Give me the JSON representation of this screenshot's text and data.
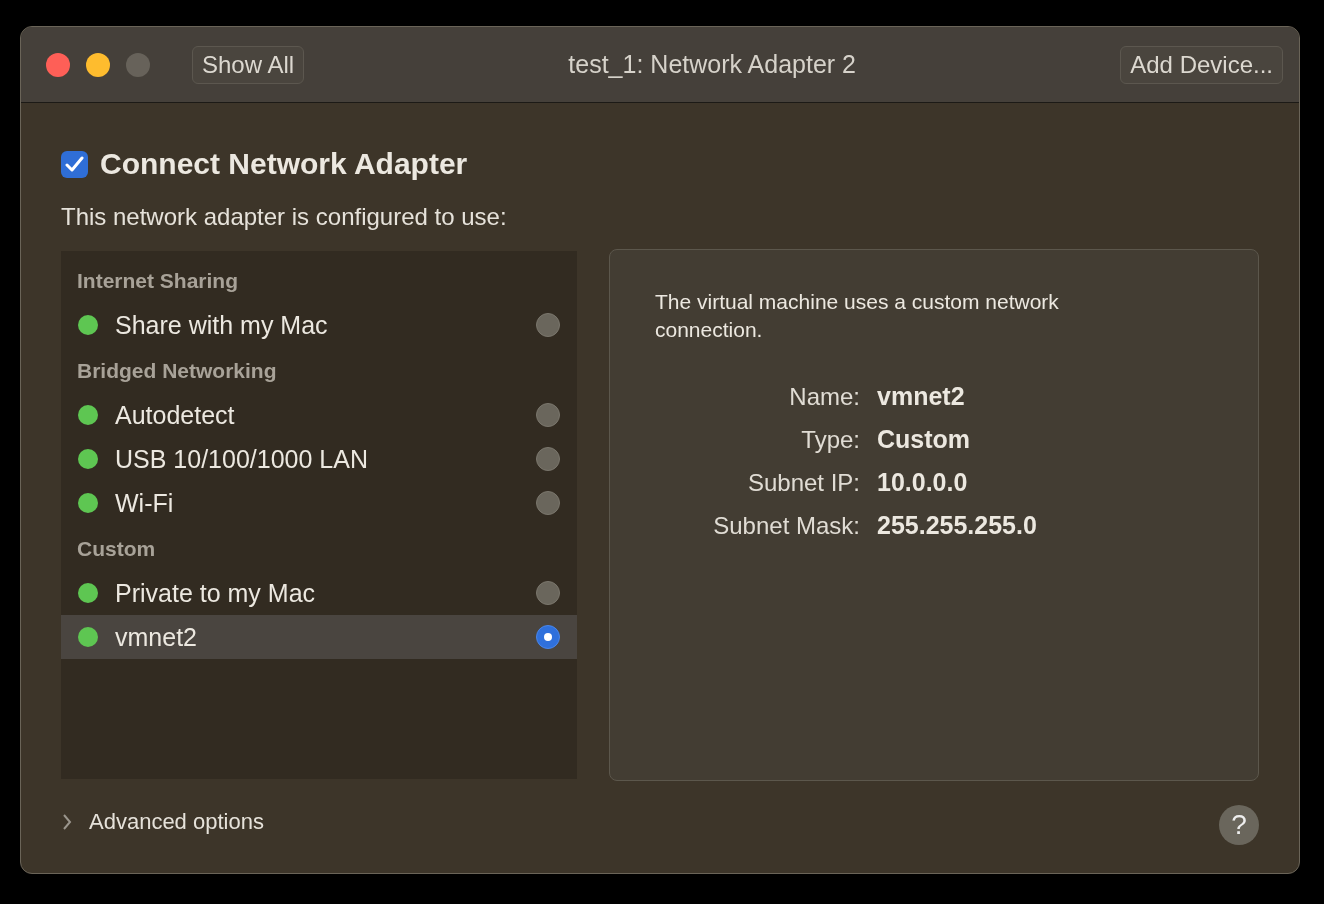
{
  "window": {
    "title": "test_1: Network Adapter 2",
    "show_all_button": "Show All",
    "add_device_button": "Add Device..."
  },
  "connect": {
    "label": "Connect Network Adapter",
    "checked": true
  },
  "intro": "This network adapter is configured to use:",
  "groups": [
    {
      "title": "Internet Sharing",
      "items": [
        {
          "label": "Share with my Mac",
          "selected": false
        }
      ]
    },
    {
      "title": "Bridged Networking",
      "items": [
        {
          "label": "Autodetect",
          "selected": false
        },
        {
          "label": "USB 10/100/1000 LAN",
          "selected": false
        },
        {
          "label": "Wi-Fi",
          "selected": false
        }
      ]
    },
    {
      "title": "Custom",
      "items": [
        {
          "label": "Private to my Mac",
          "selected": false
        },
        {
          "label": "vmnet2",
          "selected": true
        }
      ]
    }
  ],
  "details": {
    "description": "The virtual machine uses a custom network connection.",
    "fields": [
      {
        "label": "Name:",
        "value": "vmnet2"
      },
      {
        "label": "Type:",
        "value": "Custom"
      },
      {
        "label": "Subnet IP:",
        "value": "10.0.0.0"
      },
      {
        "label": "Subnet Mask:",
        "value": "255.255.255.0"
      }
    ]
  },
  "advanced": {
    "label": "Advanced options",
    "expanded": false
  },
  "help_button": "?"
}
